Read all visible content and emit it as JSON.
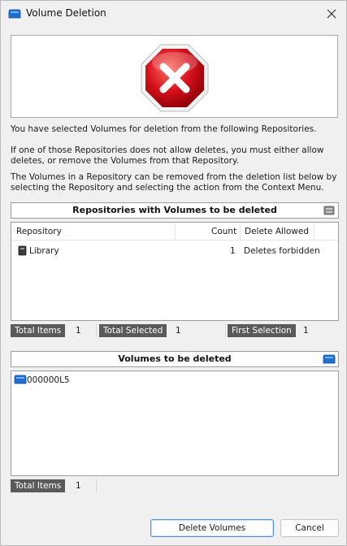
{
  "window": {
    "title": "Volume Deletion",
    "icon": "tape-volume-icon"
  },
  "messages": {
    "line1": "You have selected Volumes for deletion from the following Repositories.",
    "line2": "If one of those Repositories does not allow deletes, you must either allow deletes, or remove the Volumes from that Repository.",
    "line3": "The Volumes in a Repository can be removed from the deletion list below by selecting the Repository and selecting the action from the Context Menu."
  },
  "repositories": {
    "header": "Repositories with Volumes to be deleted",
    "columns": [
      "Repository",
      "Count",
      "Delete Allowed"
    ],
    "rows": [
      {
        "repository": "Library",
        "count": "1",
        "delete_allowed": "Deletes forbidden"
      }
    ],
    "status": {
      "total_items_label": "Total Items",
      "total_items": "1",
      "total_selected_label": "Total Selected",
      "total_selected": "1",
      "first_selection_label": "First Selection",
      "first_selection": "1"
    }
  },
  "volumes": {
    "header": "Volumes to be deleted",
    "items": [
      "000000L5"
    ],
    "status": {
      "total_items_label": "Total Items",
      "total_items": "1"
    }
  },
  "buttons": {
    "delete": "Delete Volumes",
    "cancel": "Cancel"
  },
  "colors": {
    "stop_red": "#d4101a",
    "status_label_bg": "#5a5a5a",
    "volume_blue": "#1f6fd1"
  }
}
